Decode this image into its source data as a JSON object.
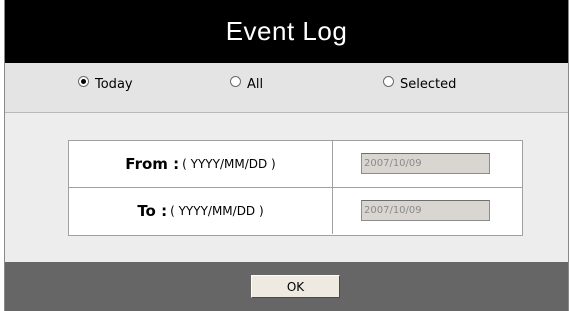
{
  "dialog": {
    "title": "Event Log"
  },
  "range_options": [
    {
      "label": "Today",
      "checked": true
    },
    {
      "label": "All",
      "checked": false
    },
    {
      "label": "Selected",
      "checked": false
    }
  ],
  "date_range": {
    "from": {
      "label": "From :",
      "format": "( YYYY/MM/DD )",
      "value": "2007/10/09"
    },
    "to": {
      "label": "To :",
      "format": "( YYYY/MM/DD )",
      "value": "2007/10/09"
    }
  },
  "footer": {
    "ok_label": "OK"
  },
  "colors": {
    "title_bg": "#000000",
    "footer_bg": "#666666",
    "input_disabled_bg": "#d9d6d2"
  }
}
